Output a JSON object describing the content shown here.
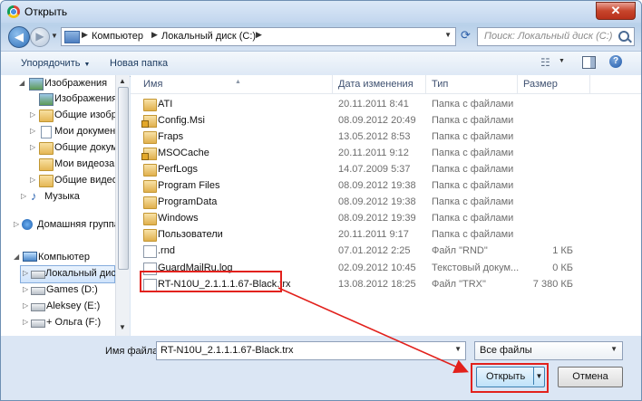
{
  "window": {
    "title": "Открыть",
    "close_glyph": "✕"
  },
  "address": {
    "segments": [
      "Компьютер",
      "Локальный диск (C:)"
    ],
    "search_placeholder": "Поиск: Локальный диск (C:)"
  },
  "toolbar": {
    "organize": "Упорядочить",
    "new_folder": "Новая папка"
  },
  "nav": {
    "items": [
      {
        "label": "Изображения"
      },
      {
        "label": "Изображения"
      },
      {
        "label": "Общие изобра"
      },
      {
        "label": "Мои документ"
      },
      {
        "label": "Общие докумен"
      },
      {
        "label": "Мои видеозап"
      },
      {
        "label": "Общие видео"
      },
      {
        "label": "Музыка"
      },
      {
        "label": "Домашняя группа"
      },
      {
        "label": "Компьютер"
      },
      {
        "label": "Локальный диск"
      },
      {
        "label": "Games (D:)"
      },
      {
        "label": "Aleksey (E:)"
      },
      {
        "label": "+ Ольга (F:)"
      }
    ]
  },
  "columns": {
    "name": "Имя",
    "date": "Дата изменения",
    "type": "Тип",
    "size": "Размер"
  },
  "files": [
    {
      "name": "ATI",
      "date": "20.11.2011 8:41",
      "type": "Папка с файлами",
      "size": "",
      "icon": "folder"
    },
    {
      "name": "Config.Msi",
      "date": "08.09.2012 20:49",
      "type": "Папка с файлами",
      "size": "",
      "icon": "folder-lock"
    },
    {
      "name": "Fraps",
      "date": "13.05.2012 8:53",
      "type": "Папка с файлами",
      "size": "",
      "icon": "folder"
    },
    {
      "name": "MSOCache",
      "date": "20.11.2011 9:12",
      "type": "Папка с файлами",
      "size": "",
      "icon": "folder-lock"
    },
    {
      "name": "PerfLogs",
      "date": "14.07.2009 5:37",
      "type": "Папка с файлами",
      "size": "",
      "icon": "folder"
    },
    {
      "name": "Program Files",
      "date": "08.09.2012 19:38",
      "type": "Папка с файлами",
      "size": "",
      "icon": "folder"
    },
    {
      "name": "ProgramData",
      "date": "08.09.2012 19:38",
      "type": "Папка с файлами",
      "size": "",
      "icon": "folder"
    },
    {
      "name": "Windows",
      "date": "08.09.2012 19:39",
      "type": "Папка с файлами",
      "size": "",
      "icon": "folder"
    },
    {
      "name": "Пользователи",
      "date": "20.11.2011 9:17",
      "type": "Папка с файлами",
      "size": "",
      "icon": "folder"
    },
    {
      "name": ".rnd",
      "date": "07.01.2012 2:25",
      "type": "Файл \"RND\"",
      "size": "1 КБ",
      "icon": "file"
    },
    {
      "name": "GuardMailRu.log",
      "date": "02.09.2012 10:45",
      "type": "Текстовый докум...",
      "size": "0 КБ",
      "icon": "file"
    },
    {
      "name": "RT-N10U_2.1.1.1.67-Black.trx",
      "date": "13.08.2012 18:25",
      "type": "Файл \"TRX\"",
      "size": "7 380 КБ",
      "icon": "file"
    }
  ],
  "bottom": {
    "filename_label": "Имя файла:",
    "filename_value": "RT-N10U_2.1.1.1.67-Black.trx",
    "filter": "Все файлы",
    "open": "Открыть",
    "cancel": "Отмена"
  },
  "colors": {
    "annotation": "#e2211c",
    "accent": "#3c7fb1"
  }
}
